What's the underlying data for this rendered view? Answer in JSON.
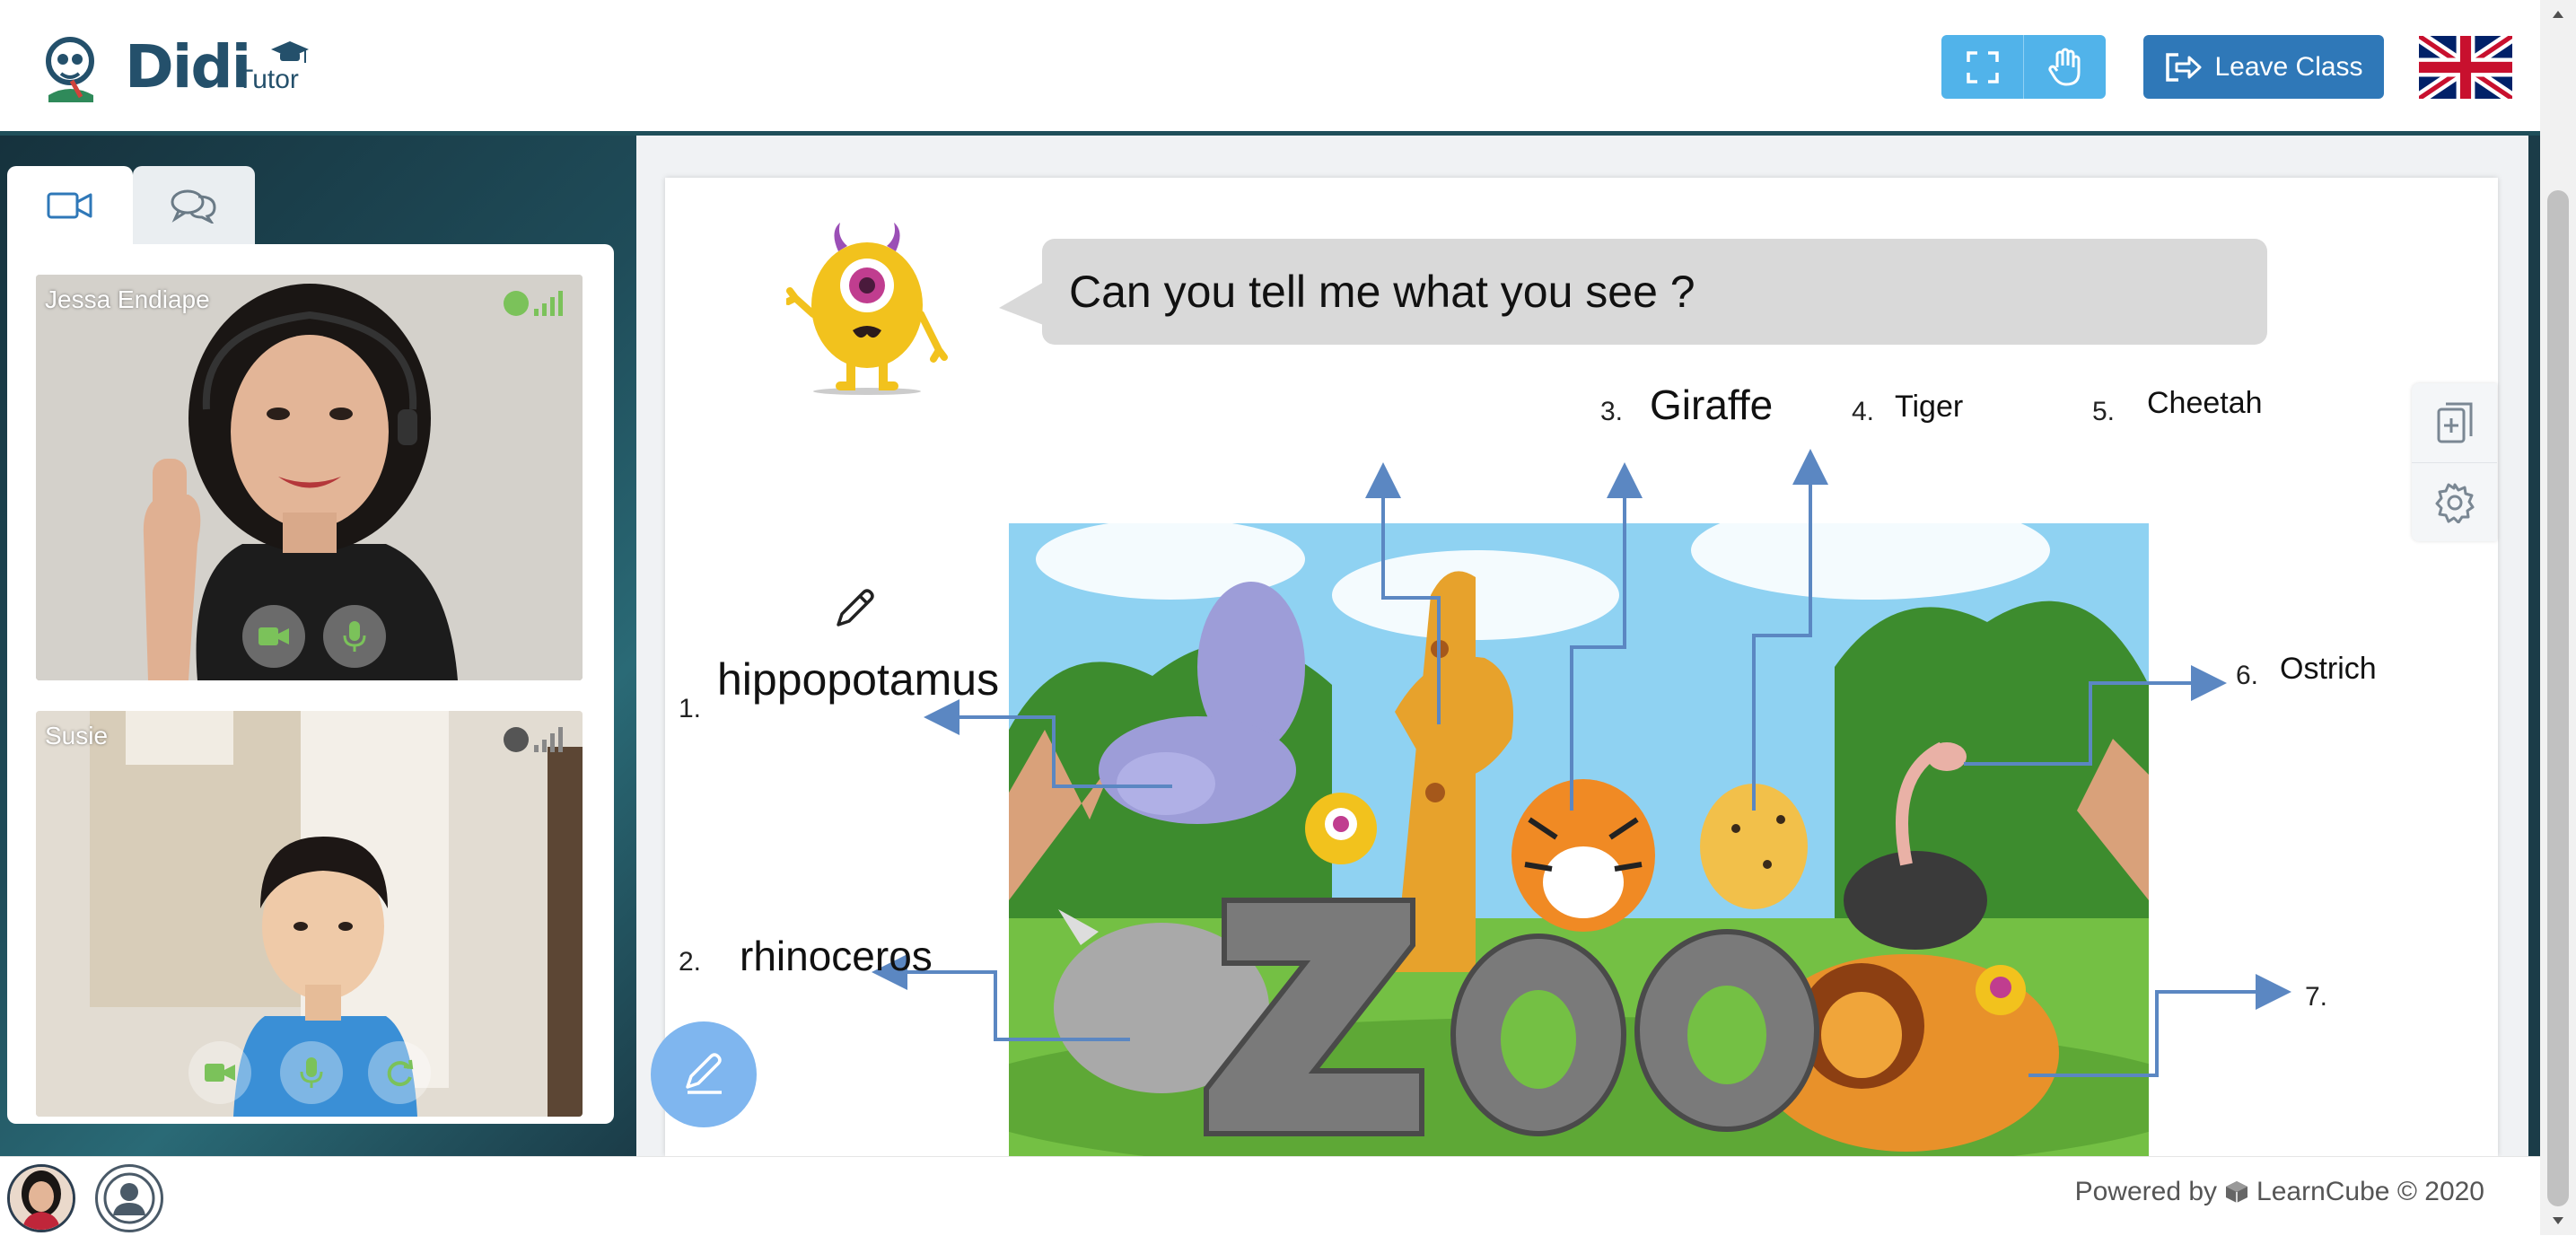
{
  "header": {
    "logo_text": "Didi",
    "logo_sub": "Tutor",
    "leave_button": "Leave Class",
    "fullscreen_icon": "fullscreen-icon",
    "raise_hand_icon": "raise-hand-icon",
    "flag_icon": "uk-flag-icon"
  },
  "left_panel": {
    "tabs": [
      {
        "icon": "video-camera-icon"
      },
      {
        "icon": "chat-bubbles-icon"
      }
    ],
    "participants": [
      {
        "name": "Jessa Endiape",
        "status_color": "#7bc25a",
        "signal_color": "#7bc25a"
      },
      {
        "name": "Susie",
        "status_color": "#555555",
        "signal_color": "#888888"
      }
    ]
  },
  "slide": {
    "question": "Can you tell me what you see ?",
    "labels": [
      {
        "num": "1.",
        "text": "hippopotamus"
      },
      {
        "num": "2.",
        "text": "rhinoceros"
      },
      {
        "num": "3.",
        "text": "Giraffe"
      },
      {
        "num": "4.",
        "text": "Tiger"
      },
      {
        "num": "5.",
        "text": "Cheetah"
      },
      {
        "num": "6.",
        "text": "Ostrich"
      },
      {
        "num": "7.",
        "text": ""
      }
    ],
    "scene_word": "ZOO"
  },
  "side_tools": {
    "add_page_icon": "add-page-icon",
    "settings_icon": "gear-icon"
  },
  "footer": {
    "powered_by": "Powered by",
    "brand": "LearnCube © 2020"
  },
  "colors": {
    "header_border": "#1f4f5a",
    "tool_blue": "#51b3ea",
    "leave_blue": "#2f78b8",
    "arrow_blue": "#5b87c2",
    "draw_button": "#7fb6ef"
  }
}
